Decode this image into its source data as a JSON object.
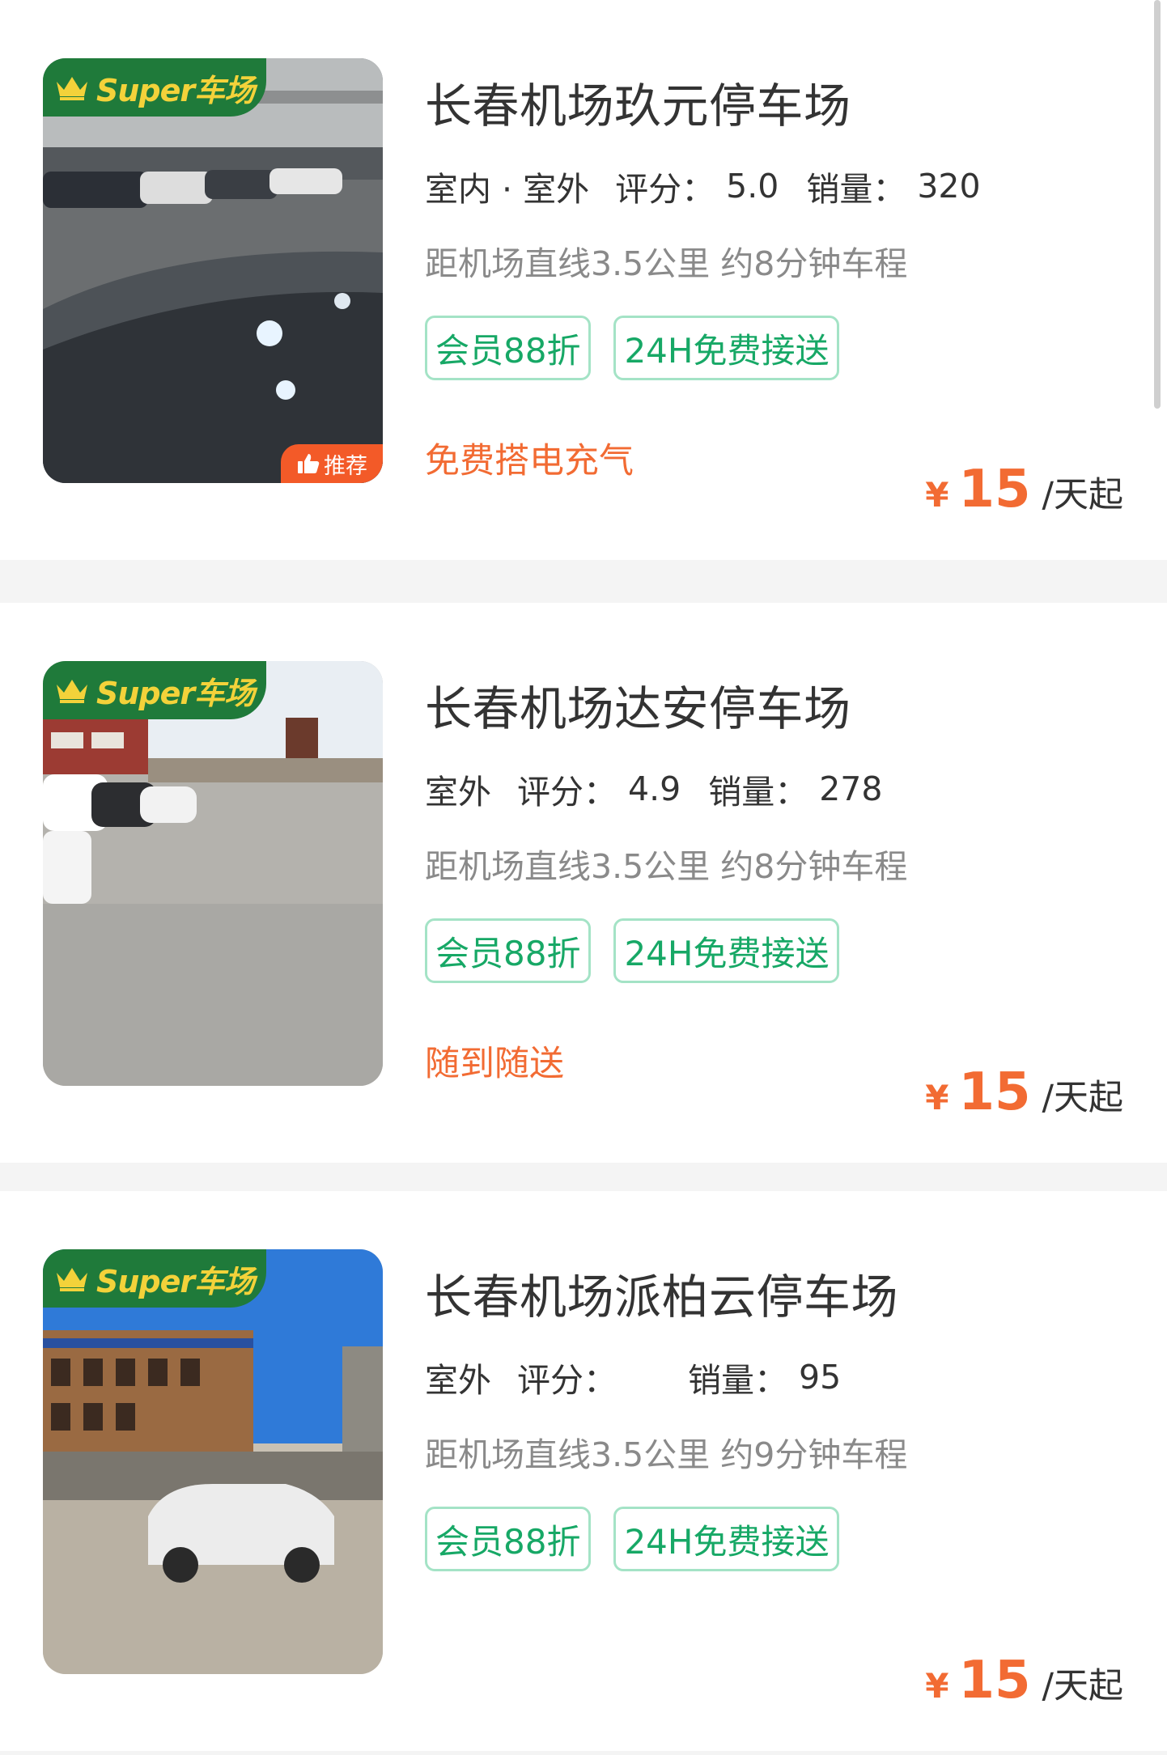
{
  "lots": [
    {
      "super_label": "Super车场",
      "title": "长春机场玖元停车场",
      "location_type": "室内 · 室外",
      "rating_label": "评分：",
      "rating_value": "5.0",
      "sales_label": "销量：",
      "sales_value": "320",
      "distance": "距机场直线3.5公里 约8分钟车程",
      "tags": [
        "会员88折",
        "24H免费接送"
      ],
      "service": "免费搭电充气",
      "recommend_label": "推荐",
      "currency": "¥",
      "price": "15",
      "price_unit": "/天起"
    },
    {
      "super_label": "Super车场",
      "title": "长春机场达安停车场",
      "location_type": "室外",
      "rating_label": "评分：",
      "rating_value": "4.9",
      "sales_label": "销量：",
      "sales_value": "278",
      "distance": "距机场直线3.5公里 约8分钟车程",
      "tags": [
        "会员88折",
        "24H免费接送"
      ],
      "service": "随到随送",
      "currency": "¥",
      "price": "15",
      "price_unit": "/天起"
    },
    {
      "super_label": "Super车场",
      "title": "长春机场派柏云停车场",
      "location_type": "室外",
      "rating_label": "评分：",
      "rating_value": "",
      "sales_label": "销量：",
      "sales_value": "95",
      "distance": "距机场直线3.5公里 约9分钟车程",
      "tags": [
        "会员88折",
        "24H免费接送"
      ],
      "service": "",
      "currency": "¥",
      "price": "15",
      "price_unit": "/天起"
    }
  ],
  "colors": {
    "brand_green": "#1f7a3a",
    "tag_green": "#17a866",
    "accent_orange": "#f26b33",
    "recommend_orange": "#f35a28"
  },
  "icons": {
    "crown": "crown-icon",
    "recommend": "thumbs-up-icon"
  }
}
